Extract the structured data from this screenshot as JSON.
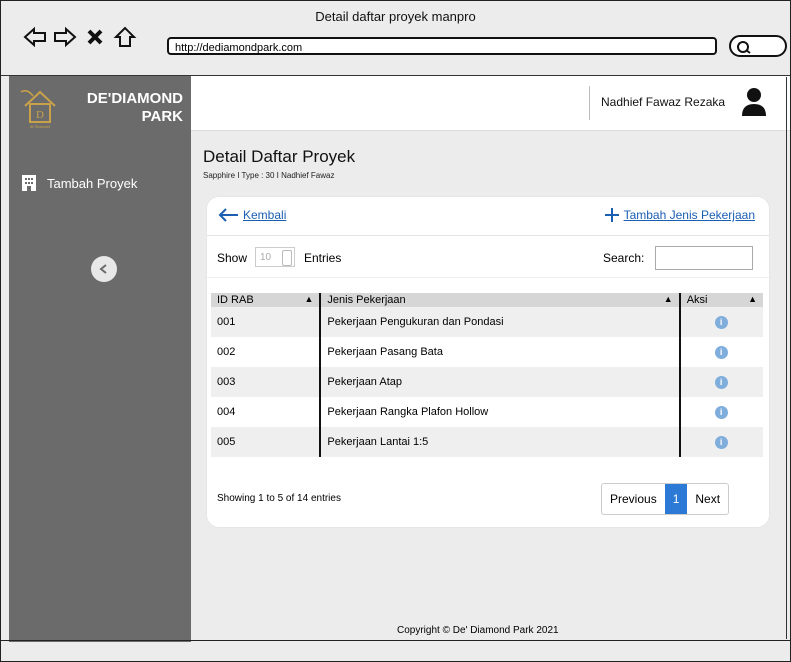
{
  "window": {
    "title": "Detail daftar proyek manpro",
    "url": "http://dediamondpark.com"
  },
  "sidebar": {
    "brand_line1": "DE'DIAMOND",
    "brand_line2": "PARK",
    "logo_caption": "de' Diamond",
    "items": [
      {
        "label": "Tambah Proyek",
        "icon": "building-icon"
      }
    ]
  },
  "header": {
    "user_name": "Nadhief Fawaz Rezaka"
  },
  "page": {
    "title": "Detail Daftar Proyek",
    "subtitle": "Sapphire I Type : 30 I Nadhief Fawaz"
  },
  "actions": {
    "back_label": "Kembali",
    "add_label": "Tambah Jenis Pekerjaan"
  },
  "table_controls": {
    "show_label": "Show",
    "entries_value": "10",
    "entries_label": "Entries",
    "search_label": "Search:"
  },
  "table": {
    "headers": [
      "ID RAB",
      "Jenis Pekerjaan",
      "Aksi"
    ],
    "rows": [
      {
        "id": "001",
        "name": "Pekerjaan Pengukuran dan Pondasi"
      },
      {
        "id": "002",
        "name": "Pekerjaan Pasang Bata"
      },
      {
        "id": "003",
        "name": "Pekerjaan Atap"
      },
      {
        "id": "004",
        "name": "Pekerjaan Rangka Plafon Hollow"
      },
      {
        "id": "005",
        "name": "Pekerjaan Lantai 1:5"
      }
    ]
  },
  "pagination": {
    "summary": "Showing 1 to 5 of 14 entries",
    "previous": "Previous",
    "current": "1",
    "next": "Next"
  },
  "footer": {
    "copyright": "Copyright © De' Diamond Park 2021"
  },
  "colors": {
    "sidebar": "#6b6b6b",
    "link": "#1b5fb3",
    "active_page": "#2d7ad6"
  }
}
